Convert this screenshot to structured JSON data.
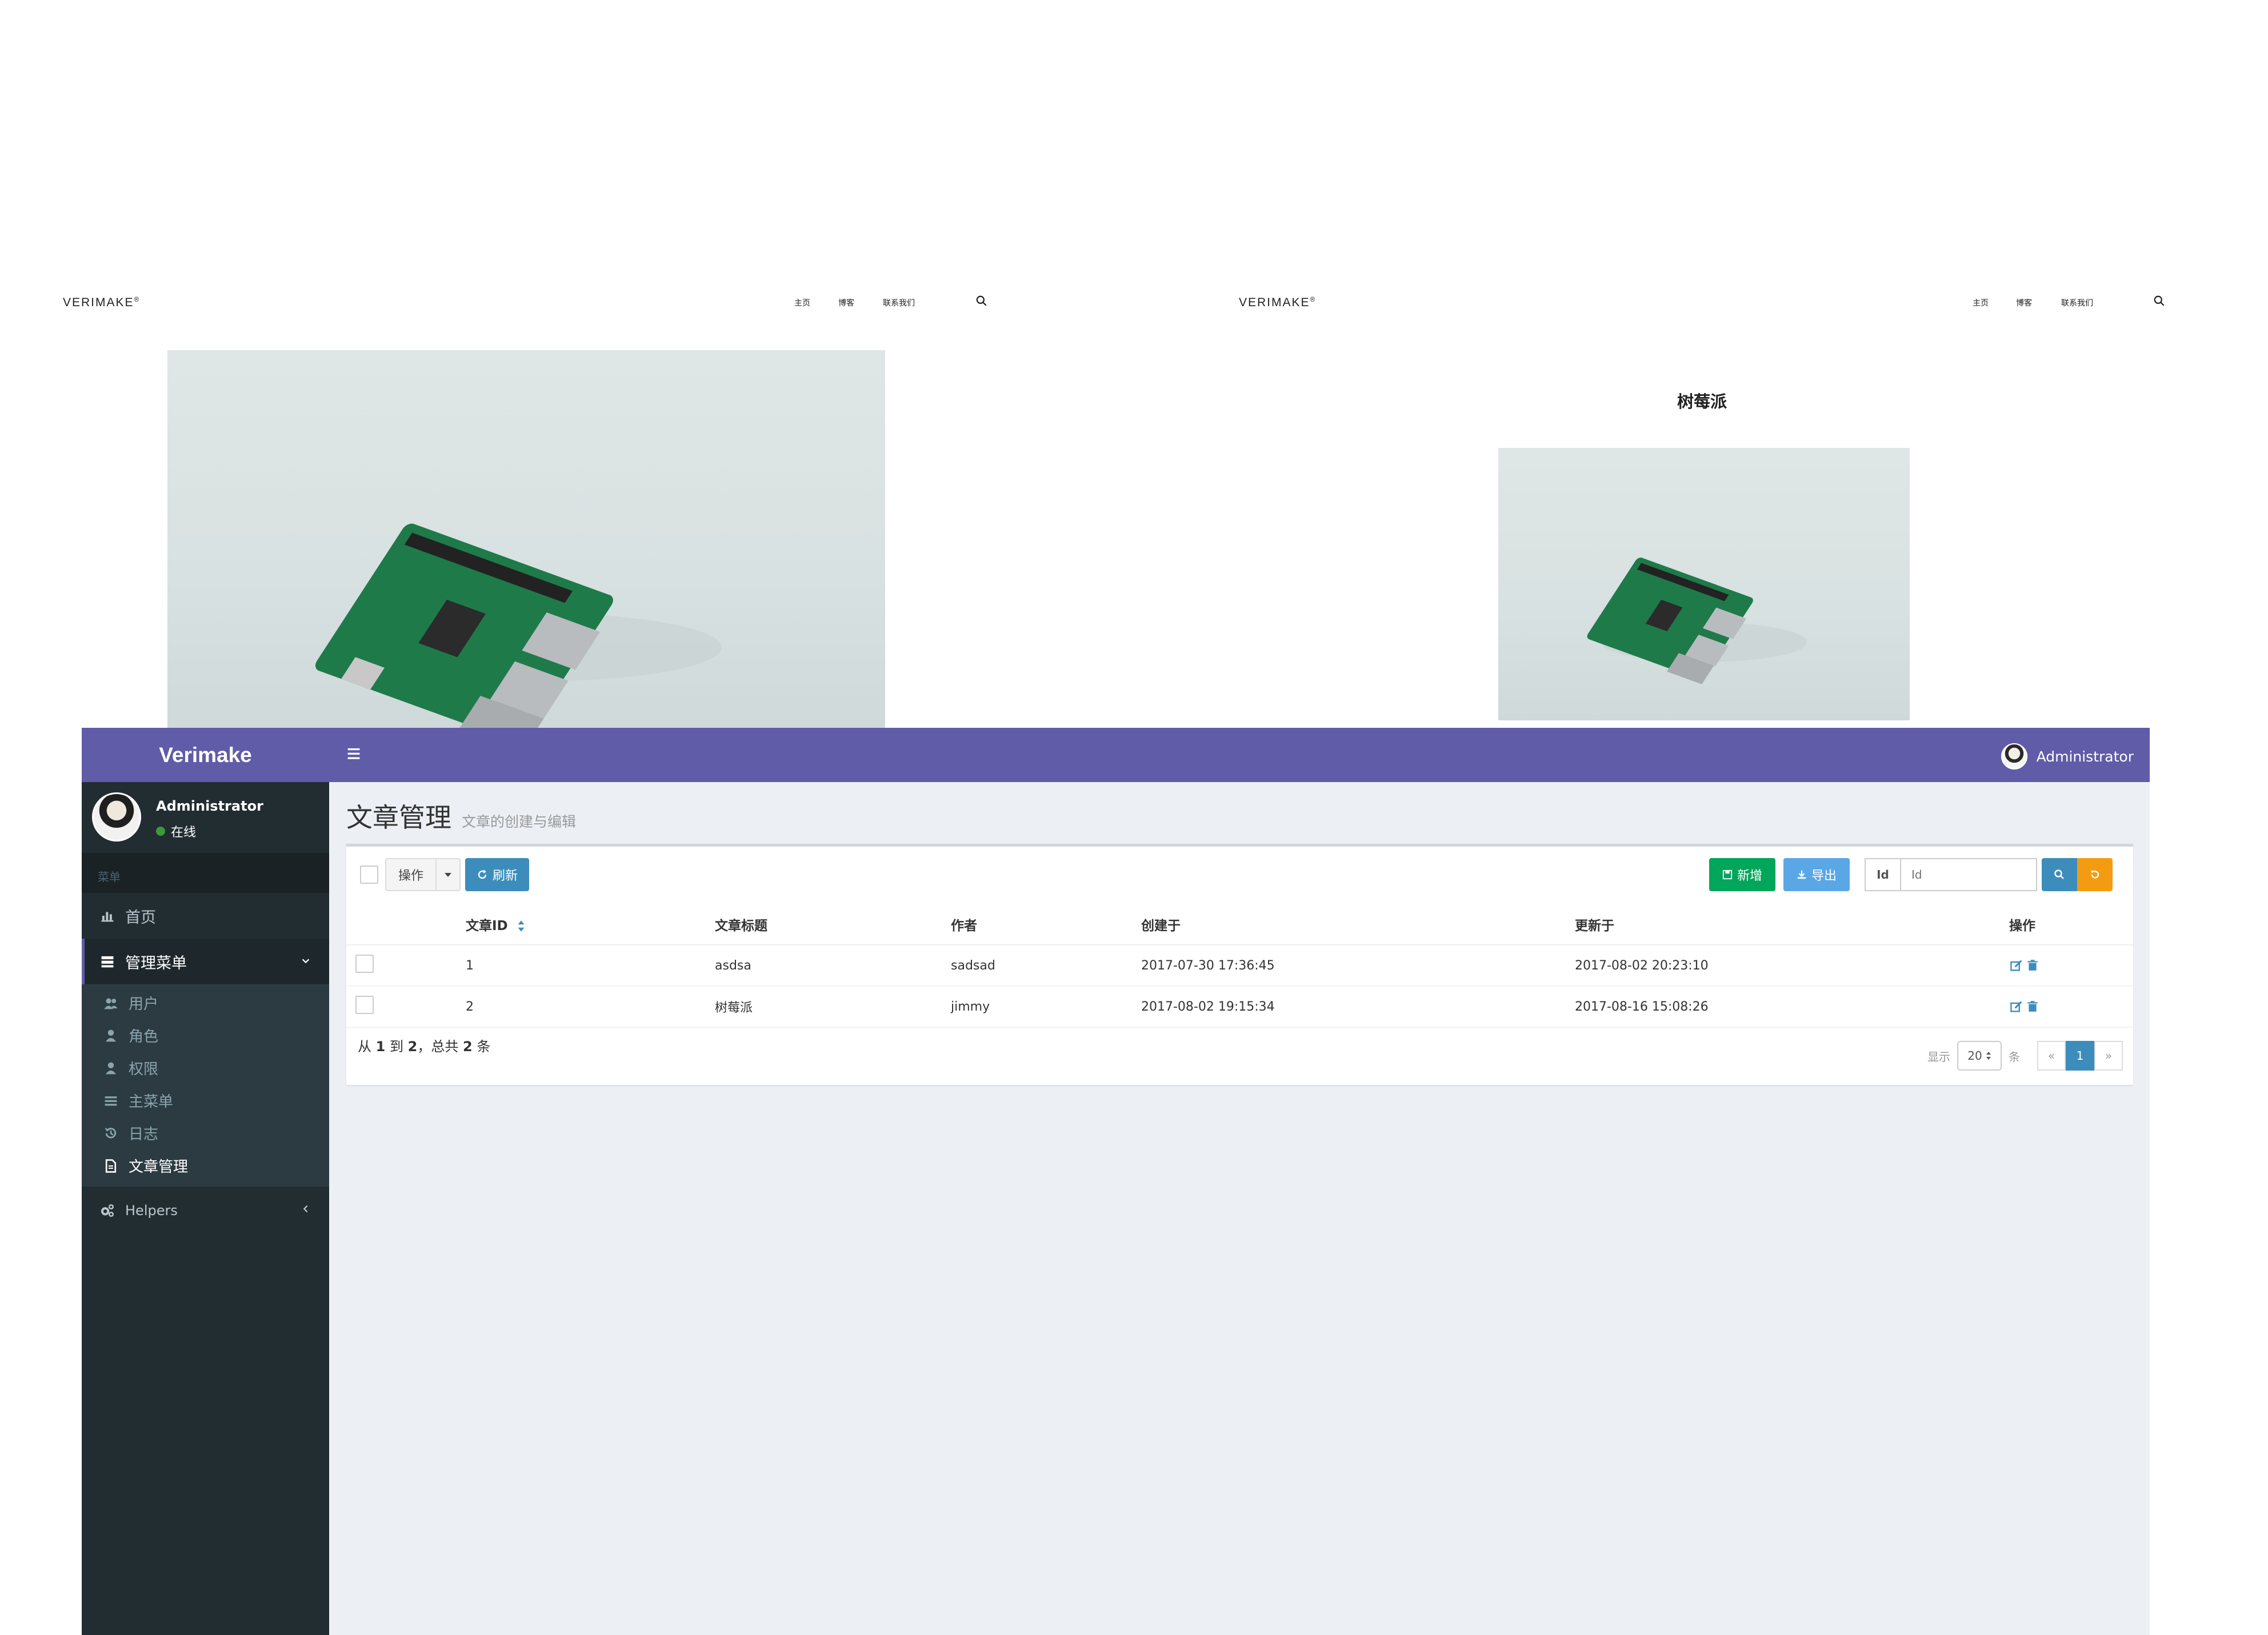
{
  "previews": {
    "left": {
      "brand": "VERIMAKE",
      "brand_mark": "®",
      "nav": [
        "主页",
        "博客",
        "联系我们"
      ]
    },
    "right": {
      "brand": "VERIMAKE",
      "brand_mark": "®",
      "nav": [
        "主页",
        "博客",
        "联系我们"
      ],
      "post_title": "树莓派"
    }
  },
  "admin": {
    "logo": "Verimake",
    "top_user": "Administrator",
    "sidebar": {
      "user_name": "Administrator",
      "status": "在线",
      "header": "菜单",
      "home": "首页",
      "manage_menu": "管理菜单",
      "sub_items": [
        {
          "label": "用户",
          "icon": "users-icon"
        },
        {
          "label": "角色",
          "icon": "user-icon"
        },
        {
          "label": "权限",
          "icon": "user-icon"
        },
        {
          "label": "主菜单",
          "icon": "list-icon"
        },
        {
          "label": "日志",
          "icon": "history-icon"
        },
        {
          "label": "文章管理",
          "icon": "file-text-icon"
        }
      ],
      "helpers": "Helpers"
    },
    "page": {
      "title": "文章管理",
      "subtitle": "文章的创建与编辑"
    },
    "toolbar": {
      "actions": "操作",
      "refresh": "刷新",
      "new": "新增",
      "export": "导出",
      "search_addon": "Id",
      "search_placeholder": "Id"
    },
    "table": {
      "headers": [
        "文章ID",
        "文章标题",
        "作者",
        "创建于",
        "更新于",
        "操作"
      ],
      "rows": [
        {
          "id": "1",
          "title": "asdsa",
          "author": "sadsad",
          "created": "2017-07-30 17:36:45",
          "updated": "2017-08-02 20:23:10"
        },
        {
          "id": "2",
          "title": "树莓派",
          "author": "jimmy",
          "created": "2017-08-02 19:15:34",
          "updated": "2017-08-16 15:08:26"
        }
      ]
    },
    "footer": {
      "from_prefix": "从",
      "from": "1",
      "to_prefix": "到",
      "to": "2",
      "total_prefix": "，总共",
      "total": "2",
      "total_suffix": "条",
      "show_label": "显示",
      "per_page": "20",
      "per_page_suffix": "条",
      "prev": "«",
      "current_page": "1",
      "next": "»"
    },
    "colors": {
      "purple": "#605ca8",
      "sidebar": "#222d32",
      "primary": "#3c8dbc",
      "success": "#00a65a",
      "warning": "#f39c12"
    }
  }
}
